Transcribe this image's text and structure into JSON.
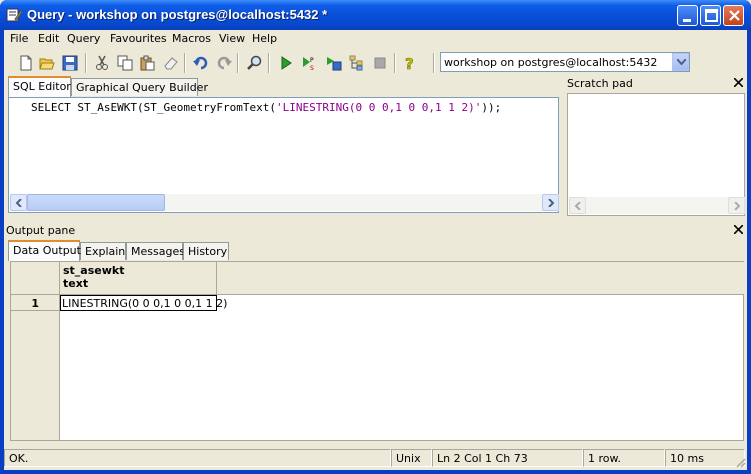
{
  "window": {
    "title": "Query - workshop on postgres@localhost:5432 *"
  },
  "menu": [
    "File",
    "Edit",
    "Query",
    "Favourites",
    "Macros",
    "View",
    "Help"
  ],
  "toolbar": {
    "connection_value": "workshop on postgres@localhost:5432"
  },
  "sql_tabs": [
    "SQL Editor",
    "Graphical Query Builder"
  ],
  "sql": {
    "prefix": "SELECT ST_AsEWKT(ST_GeometryFromText(",
    "string_literal": "'LINESTRING(0 0 0,1 0 0,1 1 2)'",
    "suffix": "));"
  },
  "scratch_pad": {
    "title": "Scratch pad"
  },
  "output_pane": {
    "title": "Output pane",
    "tabs": [
      "Data Output",
      "Explain",
      "Messages",
      "History"
    ]
  },
  "grid": {
    "column_name": "st_asewkt",
    "column_type": "text",
    "rows": [
      {
        "num": "1",
        "value": "LINESTRING(0 0 0,1 0 0,1 1 2)"
      }
    ]
  },
  "status": {
    "message": "OK.",
    "line_endings": "Unix",
    "position": "Ln 2 Col 1 Ch 73",
    "rows": "1 row.",
    "time": "10 ms"
  },
  "colors": {
    "title_bar": "#0a4fd9",
    "string_literal": "#8b008b",
    "active_tab_accent": "#e68b2c"
  }
}
